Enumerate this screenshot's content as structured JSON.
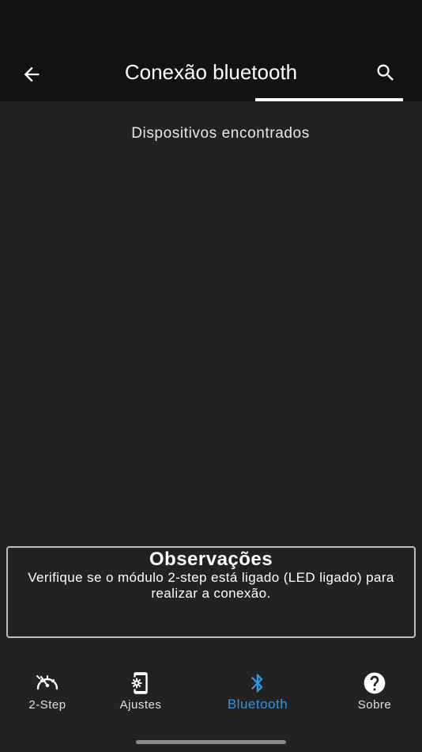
{
  "header": {
    "title": "Conexão bluetooth",
    "back_icon": "arrow-left-icon",
    "search_icon": "search-icon"
  },
  "main": {
    "section_heading": "Dispositivos encontrados",
    "devices": []
  },
  "notes": {
    "title": "Observações",
    "text": "Verifique se o módulo 2-step está ligado (LED ligado) para realizar a conexão."
  },
  "bottom_nav": {
    "items": [
      {
        "label": "2-Step",
        "icon": "speedometer-icon",
        "active": false
      },
      {
        "label": "Ajustes",
        "icon": "phone-settings-icon",
        "active": false
      },
      {
        "label": "Bluetooth",
        "icon": "bluetooth-icon",
        "active": true
      },
      {
        "label": "Sobre",
        "icon": "help-circle-icon",
        "active": false
      }
    ]
  },
  "colors": {
    "background": "#222222",
    "app_bar": "#121212",
    "accent": "#2f95dc",
    "text": "#ffffff"
  }
}
